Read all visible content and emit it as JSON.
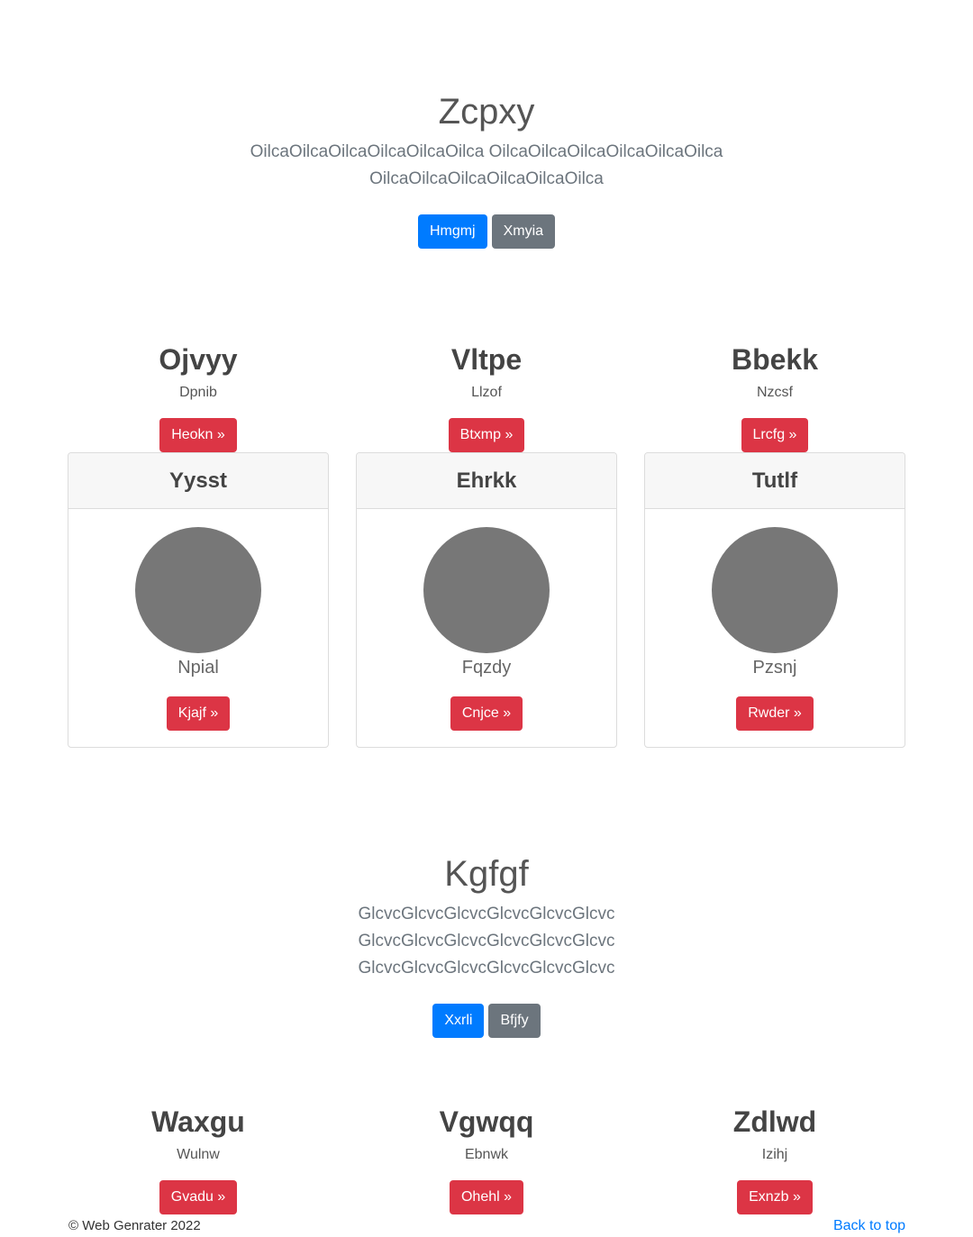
{
  "section1": {
    "title": "Zcpxy",
    "lead": "OilcaOilcaOilcaOilcaOilcaOilca OilcaOilcaOilcaOilcaOilcaOilca OilcaOilcaOilcaOilcaOilcaOilca",
    "primary_btn": "Hmgmj",
    "secondary_btn": "Xmyia"
  },
  "row1": [
    {
      "title": "Ojvyy",
      "sub": "Dpnib",
      "btn": "Heokn »"
    },
    {
      "title": "Vltpe",
      "sub": "Llzof",
      "btn": "Btxmp »"
    },
    {
      "title": "Bbekk",
      "sub": "Nzcsf",
      "btn": "Lrcfg »"
    }
  ],
  "cards": [
    {
      "header": "Yysst",
      "name": "Npial",
      "btn": "Kjajf »"
    },
    {
      "header": "Ehrkk",
      "name": "Fqzdy",
      "btn": "Cnjce »"
    },
    {
      "header": "Tutlf",
      "name": "Pzsnj",
      "btn": "Rwder »"
    }
  ],
  "section2": {
    "title": "Kgfgf",
    "lead": "GlcvcGlcvcGlcvcGlcvcGlcvcGlcvc GlcvcGlcvcGlcvcGlcvcGlcvcGlcvc GlcvcGlcvcGlcvcGlcvcGlcvcGlcvc",
    "primary_btn": "Xxrli",
    "secondary_btn": "Bfjfy"
  },
  "row2": [
    {
      "title": "Waxgu",
      "sub": "Wulnw",
      "btn": "Gvadu »"
    },
    {
      "title": "Vgwqq",
      "sub": "Ebnwk",
      "btn": "Ohehl »"
    },
    {
      "title": "Zdlwd",
      "sub": "Izihj",
      "btn": "Exnzb »"
    }
  ],
  "footer": {
    "copyright": "© Web Genrater 2022",
    "back_to_top": "Back to top"
  }
}
